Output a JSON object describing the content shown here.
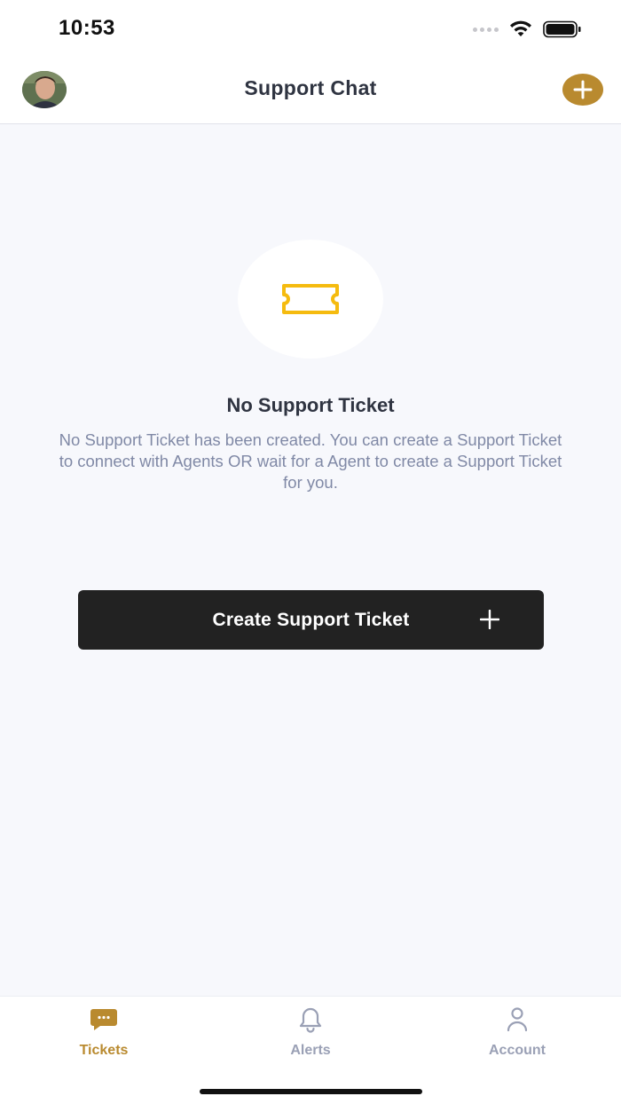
{
  "status_bar": {
    "time": "10:53"
  },
  "header": {
    "title": "Support Chat",
    "avatar_icon": "user-avatar",
    "add_icon": "plus-icon"
  },
  "empty_state": {
    "icon": "ticket-icon",
    "title": "No Support Ticket",
    "description": "No Support Ticket has been created. You can create a Support Ticket to connect with Agents OR wait for a Agent to create a Support Ticket for you."
  },
  "create_button": {
    "label": "Create Support Ticket",
    "icon": "plus-icon"
  },
  "tabs": [
    {
      "label": "Tickets",
      "icon": "chat-icon",
      "active": true
    },
    {
      "label": "Alerts",
      "icon": "bell-icon",
      "active": false
    },
    {
      "label": "Account",
      "icon": "person-icon",
      "active": false
    }
  ],
  "colors": {
    "accent": "#b98a2f",
    "ticket_icon": "#f5bb0f",
    "button_bg": "#222222",
    "background": "#f7f8fc",
    "muted_text": "#8089a6"
  }
}
